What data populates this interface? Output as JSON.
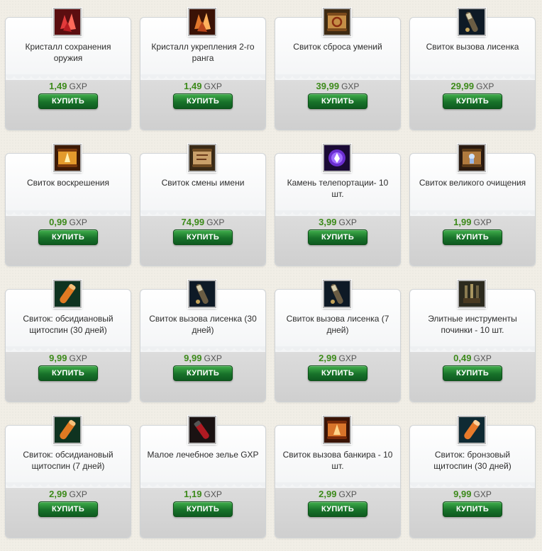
{
  "currency": "GXP",
  "buy_label": "КУПИТЬ",
  "items": [
    {
      "name": "Кристалл сохранения оружия",
      "price": "1,49",
      "icon": "red-crystal-icon"
    },
    {
      "name": "Кристалл укрепления 2-го ранга",
      "price": "1,49",
      "icon": "orange-crystal-icon"
    },
    {
      "name": "Свиток сброса умений",
      "price": "39,99",
      "icon": "reset-scroll-icon"
    },
    {
      "name": "Свиток вызова лисенка",
      "price": "29,99",
      "icon": "fox-scroll-icon"
    },
    {
      "name": "Свиток воскрешения",
      "price": "0,99",
      "icon": "resurrection-scroll-icon"
    },
    {
      "name": "Свиток смены имени",
      "price": "74,99",
      "icon": "rename-scroll-icon"
    },
    {
      "name": "Камень телепортации- 10 шт.",
      "price": "3,99",
      "icon": "teleport-stone-icon"
    },
    {
      "name": "Свиток великого очищения",
      "price": "1,99",
      "icon": "purification-scroll-icon"
    },
    {
      "name": "Свиток: обсидиановый щитоспин (30 дней)",
      "price": "9,99",
      "icon": "obsidian-scroll-icon"
    },
    {
      "name": "Свиток вызова лисенка (30 дней)",
      "price": "9,99",
      "icon": "fox-scroll-icon"
    },
    {
      "name": "Свиток вызова лисенка (7 дней)",
      "price": "2,99",
      "icon": "fox-scroll-icon"
    },
    {
      "name": "Элитные инструменты починки - 10 шт.",
      "price": "0,49",
      "icon": "repair-tools-icon"
    },
    {
      "name": "Свиток: обсидиановый щитоспин (7 дней)",
      "price": "2,99",
      "icon": "obsidian-scroll-icon"
    },
    {
      "name": "Малое лечебное зелье GXP",
      "price": "1,19",
      "icon": "healing-potion-icon"
    },
    {
      "name": "Свиток вызова банкира - 10 шт.",
      "price": "2,99",
      "icon": "banker-scroll-icon"
    },
    {
      "name": "Свиток: бронзовый щитоспин (30 дней)",
      "price": "9,99",
      "icon": "bronze-scroll-icon"
    }
  ]
}
